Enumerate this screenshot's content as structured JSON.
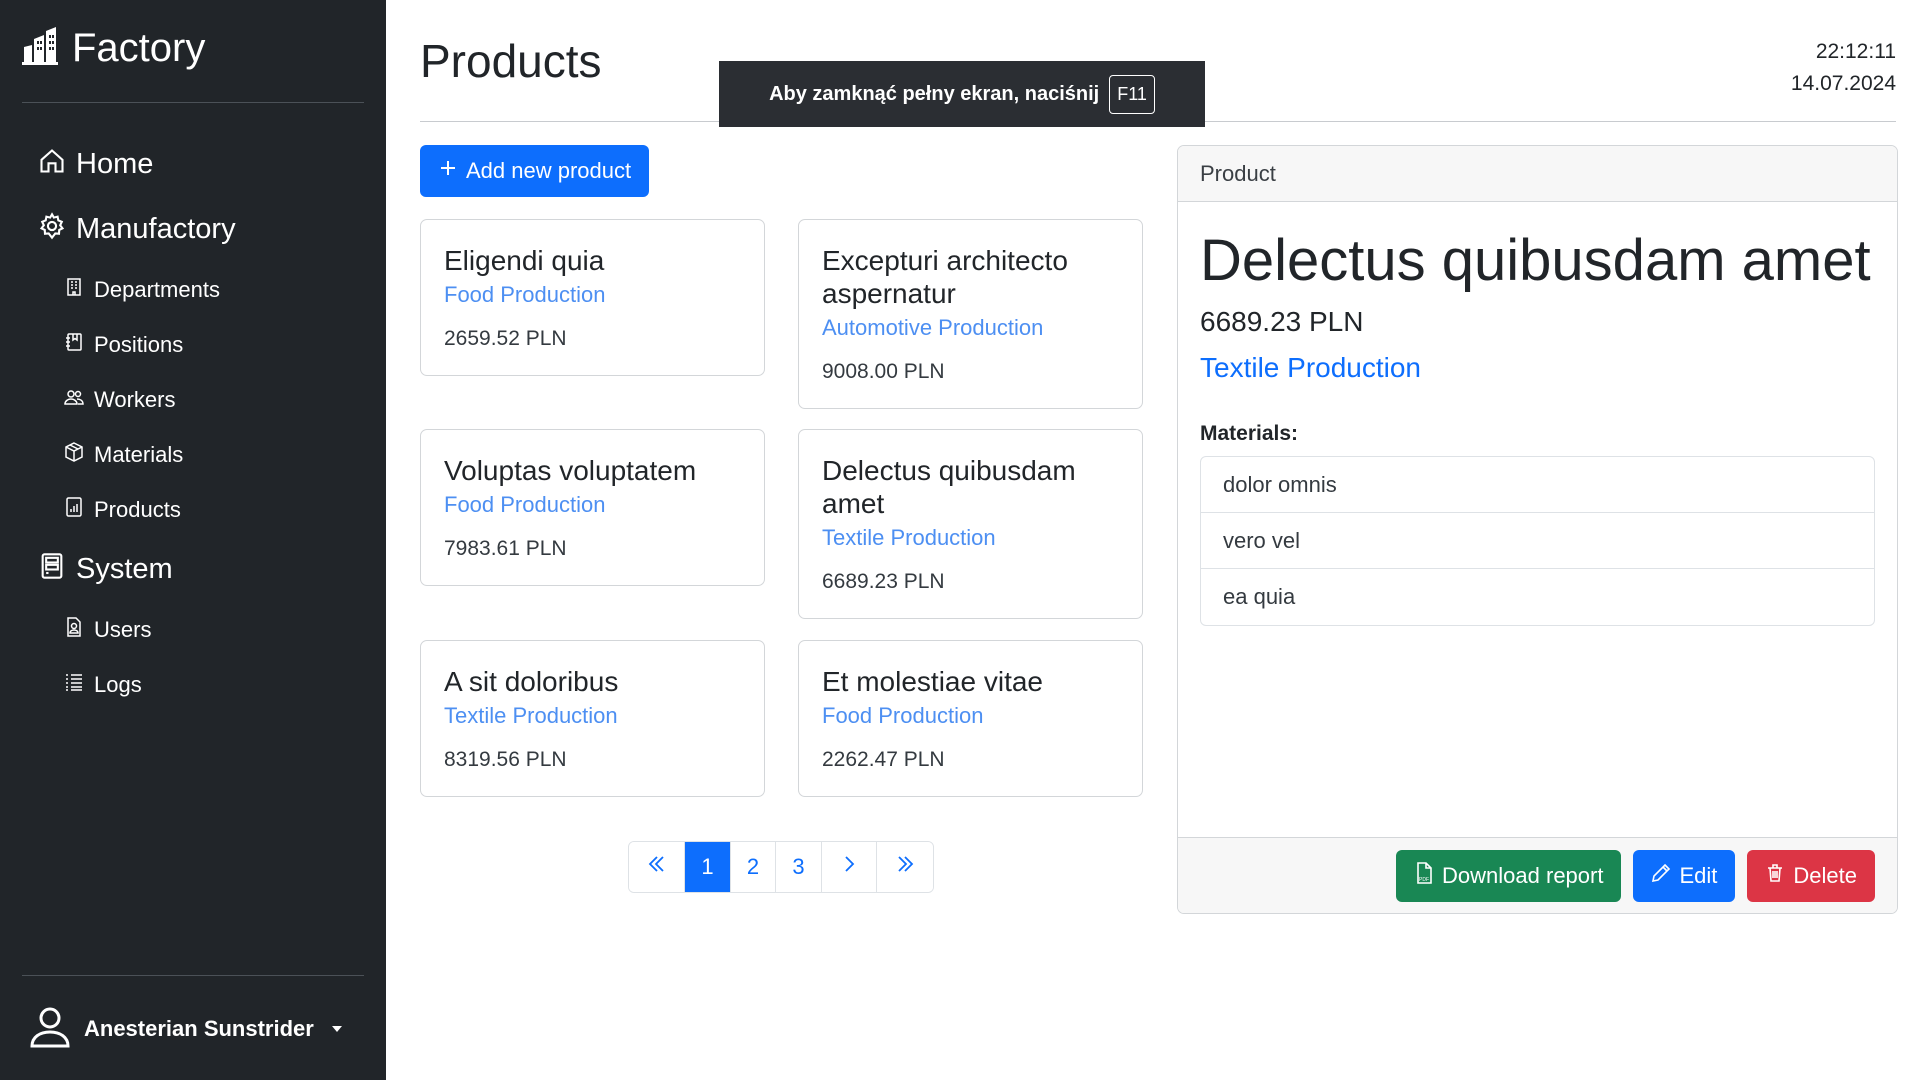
{
  "app": {
    "brand": "Factory"
  },
  "sidebar": {
    "sections": [
      {
        "label": "Home",
        "icon": "house-icon"
      },
      {
        "label": "Manufactory",
        "icon": "gear-icon",
        "items": [
          {
            "label": "Departments",
            "icon": "building-icon"
          },
          {
            "label": "Positions",
            "icon": "journal-icon"
          },
          {
            "label": "Workers",
            "icon": "people-icon"
          },
          {
            "label": "Materials",
            "icon": "box-icon"
          },
          {
            "label": "Products",
            "icon": "chart-file-icon"
          }
        ]
      },
      {
        "label": "System",
        "icon": "server-icon",
        "items": [
          {
            "label": "Users",
            "icon": "person-file-icon"
          },
          {
            "label": "Logs",
            "icon": "list-icon"
          }
        ]
      }
    ],
    "user": {
      "name": "Anesterian Sunstrider"
    }
  },
  "header": {
    "title": "Products",
    "time": "22:12:11",
    "date": "14.07.2024"
  },
  "fullscreen_notice": {
    "text": "Aby zamknąć pełny ekran, naciśnij",
    "key": "F11"
  },
  "toolbar": {
    "add_label": "Add new product"
  },
  "products": [
    {
      "name": "Eligendi quia",
      "category": "Food Production",
      "price": "2659.52 PLN"
    },
    {
      "name": "Excepturi architecto aspernatur",
      "category": "Automotive Production",
      "price": "9008.00 PLN"
    },
    {
      "name": "Voluptas voluptatem",
      "category": "Food Production",
      "price": "7983.61 PLN"
    },
    {
      "name": "Delectus quibusdam amet",
      "category": "Textile Production",
      "price": "6689.23 PLN"
    },
    {
      "name": "A sit doloribus",
      "category": "Textile Production",
      "price": "8319.56 PLN"
    },
    {
      "name": "Et molestiae vitae",
      "category": "Food Production",
      "price": "2262.47 PLN"
    }
  ],
  "pagination": {
    "pages": [
      "1",
      "2",
      "3"
    ],
    "current": "1"
  },
  "detail": {
    "header": "Product",
    "name": "Delectus quibusdam amet",
    "price": "6689.23 PLN",
    "category": "Textile Production",
    "materials_label": "Materials:",
    "materials": [
      "dolor omnis",
      "vero vel",
      "ea quia"
    ],
    "actions": {
      "download": "Download report",
      "edit": "Edit",
      "delete": "Delete"
    }
  },
  "colors": {
    "sidebar": "#212529",
    "primary": "#0d6efd",
    "success": "#198754",
    "danger": "#dc3545"
  }
}
